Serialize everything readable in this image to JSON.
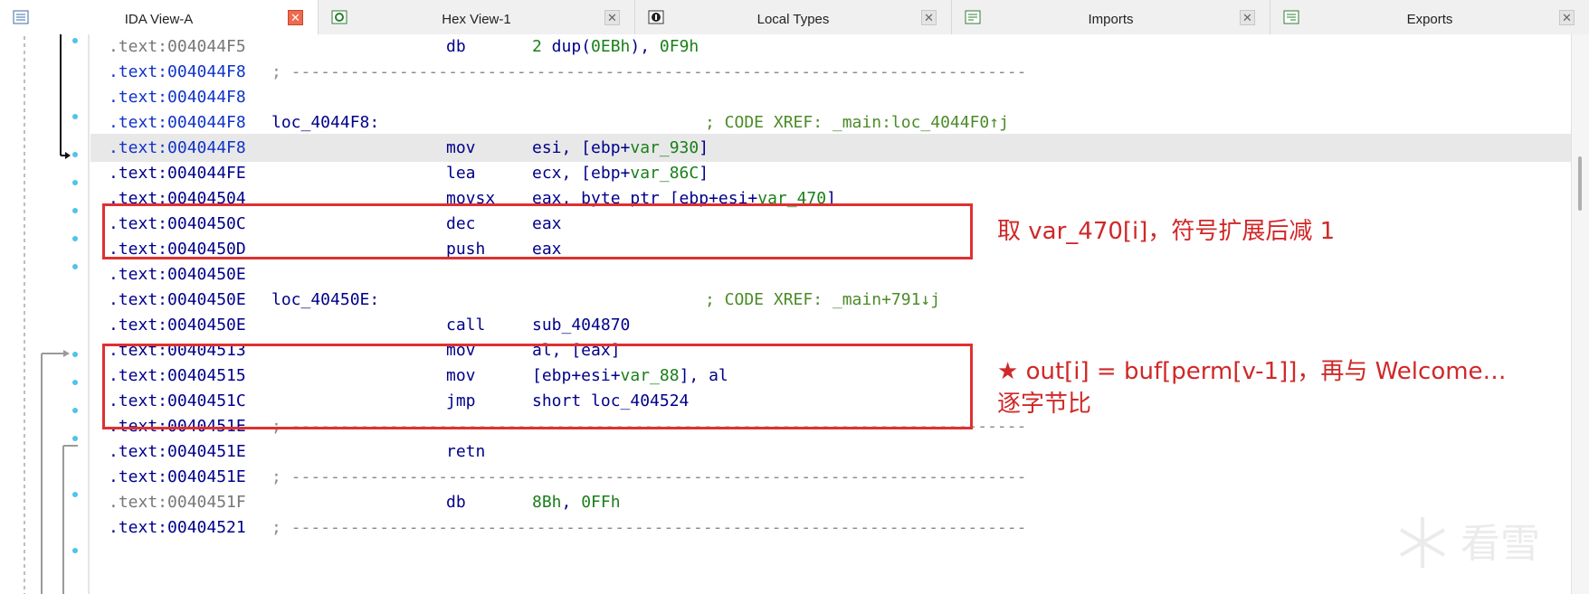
{
  "tabs": [
    {
      "label": "IDA View-A",
      "active": true,
      "icon": "text-view-icon"
    },
    {
      "label": "Hex View-1",
      "active": false,
      "icon": "hex-view-icon"
    },
    {
      "label": "Local Types",
      "active": false,
      "icon": "local-types-icon"
    },
    {
      "label": "Imports",
      "active": false,
      "icon": "imports-icon"
    },
    {
      "label": "Exports",
      "active": false,
      "icon": "exports-icon"
    }
  ],
  "close_glyph": "✕",
  "listing": [
    {
      "addr": ".text:004044F5",
      "style": "gray",
      "mnem": "db",
      "ops": "2 dup(0EBh), 0F9h",
      "kind": "data"
    },
    {
      "addr": ".text:004044F8",
      "style": "blue",
      "kind": "dash",
      "dash": "; ---------------------------------------------------------------------------"
    },
    {
      "addr": ".text:004044F8",
      "style": "blue",
      "kind": "blank"
    },
    {
      "addr": ".text:004044F8",
      "style": "blue",
      "kind": "label",
      "label": "loc_4044F8:",
      "comment": "; CODE XREF: _main:loc_4044F0↑j"
    },
    {
      "addr": ".text:004044F8",
      "style": "blue",
      "mnem": "mov",
      "ops": "esi, [ebp+var_930]",
      "kind": "ins",
      "highlight": true
    },
    {
      "addr": ".text:004044FE",
      "style": "navy",
      "mnem": "lea",
      "ops": "ecx, [ebp+var_86C]",
      "kind": "ins"
    },
    {
      "addr": ".text:00404504",
      "style": "navy",
      "mnem": "movsx",
      "ops": "eax, byte ptr [ebp+esi+var_470]",
      "kind": "ins"
    },
    {
      "addr": ".text:0040450C",
      "style": "navy",
      "mnem": "dec",
      "ops": "eax",
      "kind": "ins"
    },
    {
      "addr": ".text:0040450D",
      "style": "navy",
      "mnem": "push",
      "ops": "eax",
      "kind": "ins"
    },
    {
      "addr": ".text:0040450E",
      "style": "navy",
      "kind": "blank"
    },
    {
      "addr": ".text:0040450E",
      "style": "navy",
      "kind": "label",
      "label": "loc_40450E:",
      "comment": "; CODE XREF: _main+791↓j"
    },
    {
      "addr": ".text:0040450E",
      "style": "navy",
      "mnem": "call",
      "ops": "sub_404870",
      "kind": "ins"
    },
    {
      "addr": ".text:00404513",
      "style": "navy",
      "mnem": "mov",
      "ops": "al, [eax]",
      "kind": "ins"
    },
    {
      "addr": ".text:00404515",
      "style": "navy",
      "mnem": "mov",
      "ops": "[ebp+esi+var_88], al",
      "kind": "ins"
    },
    {
      "addr": ".text:0040451C",
      "style": "navy",
      "mnem": "jmp",
      "ops": "short loc_404524",
      "kind": "ins"
    },
    {
      "addr": ".text:0040451E",
      "style": "navy",
      "kind": "dash",
      "dash": "; ---------------------------------------------------------------------------"
    },
    {
      "addr": ".text:0040451E",
      "style": "navy",
      "mnem": "retn",
      "ops": "",
      "kind": "ins"
    },
    {
      "addr": ".text:0040451E",
      "style": "navy",
      "kind": "dash",
      "dash": "; ---------------------------------------------------------------------------"
    },
    {
      "addr": ".text:0040451F",
      "style": "gray",
      "mnem": "db",
      "ops": "8Bh, 0FFh",
      "kind": "data"
    },
    {
      "addr": ".text:00404521",
      "style": "navy",
      "kind": "dash",
      "dash": "; ---------------------------------------------------------------------------"
    }
  ],
  "annotations": {
    "note1": "取 var_470[i]，符号扩展后减 1",
    "note2_line1": "★ out[i] = buf[perm[v-1]]，再与 Welcome…",
    "note2_line2": "逐字节比"
  },
  "watermark": "看雪",
  "colors": {
    "annotation": "#e03030",
    "highlight": "#e8e8e8",
    "dot": "#4fc3ef"
  }
}
